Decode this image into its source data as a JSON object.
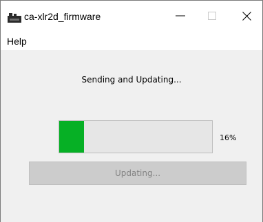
{
  "window": {
    "title": "ca-xlr2d_firmware",
    "icon": "app-icon"
  },
  "menu": {
    "items": [
      {
        "label": "Help"
      }
    ]
  },
  "main": {
    "status_text": "Sending and Updating...",
    "progress_percent": 16,
    "progress_label": "16%",
    "button_label": "Updating...",
    "button_enabled": false
  },
  "colors": {
    "progress_fill": "#06b025",
    "client_background": "#f0f0f0",
    "disabled_button": "#cccccc"
  }
}
